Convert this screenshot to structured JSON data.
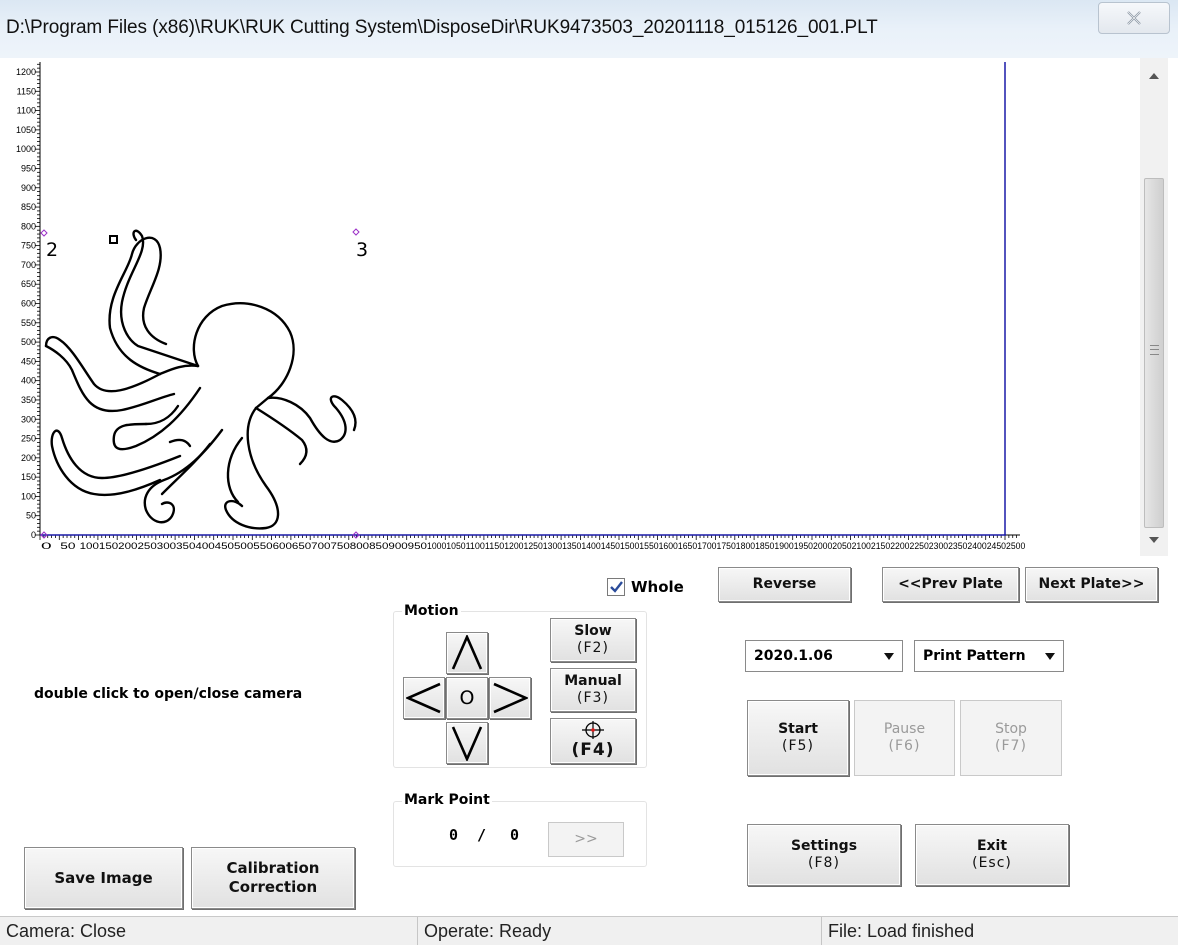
{
  "window": {
    "title": "D:\\Program Files (x86)\\RUK\\RUK Cutting System\\DisposeDir\\RUK9473503_20201118_015126_001.PLT"
  },
  "plot": {
    "x_tick_labels": [
      "0",
      "50",
      "100",
      "150",
      "200",
      "250",
      "300",
      "350",
      "400",
      "450",
      "500",
      "550",
      "600",
      "650",
      "700",
      "750",
      "800",
      "850",
      "900",
      "950",
      "1000",
      "1050",
      "1100",
      "1150",
      "1200",
      "1250",
      "1300",
      "1350",
      "1400",
      "1450",
      "1500",
      "1550",
      "1600",
      "1650",
      "1700",
      "1750",
      "1800",
      "1850",
      "1900",
      "1950",
      "2000",
      "2050",
      "2100",
      "2150",
      "2200",
      "2250",
      "2300",
      "2350",
      "2400",
      "2450",
      "2500"
    ],
    "y_tick_labels": [
      "0",
      "50",
      "100",
      "150",
      "200",
      "250",
      "300",
      "350",
      "400",
      "450",
      "500",
      "550",
      "600",
      "650",
      "700",
      "750",
      "800",
      "850",
      "900",
      "950",
      "1000",
      "1050",
      "1100",
      "1150",
      "1200"
    ],
    "mark_labels": [
      "2",
      "3"
    ],
    "colors": {
      "outline": "#000000",
      "border": "#1a1aa8",
      "marker": "#9b2fc7"
    }
  },
  "whole_checkbox": {
    "label": "Whole",
    "checked": true
  },
  "buttons": {
    "reverse": "Reverse",
    "prev_plate": "<<Prev Plate",
    "next_plate": "Next Plate>>",
    "slow": {
      "label": "Slow",
      "key": "(F2)"
    },
    "manual": {
      "label": "Manual",
      "key": "(F3)"
    },
    "crosshair": {
      "key": "(F4)"
    },
    "origin": "O",
    "mark_next": ">>",
    "start": {
      "label": "Start",
      "key": "(F5)"
    },
    "pause": {
      "label": "Pause",
      "key": "(F6)"
    },
    "stop": {
      "label": "Stop",
      "key": "(F7)"
    },
    "settings": {
      "label": "Settings",
      "key": "(F8)"
    },
    "exit": {
      "label": "Exit",
      "key": "(Esc)"
    },
    "save_image": "Save Image",
    "calibration": {
      "line1": "Calibration",
      "line2": "Correction"
    }
  },
  "motion": {
    "title": "Motion"
  },
  "mark_point": {
    "title": "Mark Point",
    "current": "0",
    "separator": "/",
    "total": "0"
  },
  "camera_hint": "double click to open/close camera",
  "version_select": {
    "value": "2020.1.06"
  },
  "mode_select": {
    "value": "Print Pattern"
  },
  "status": {
    "camera": "Camera: Close",
    "operate": "Operate: Ready",
    "file": "File: Load finished"
  }
}
